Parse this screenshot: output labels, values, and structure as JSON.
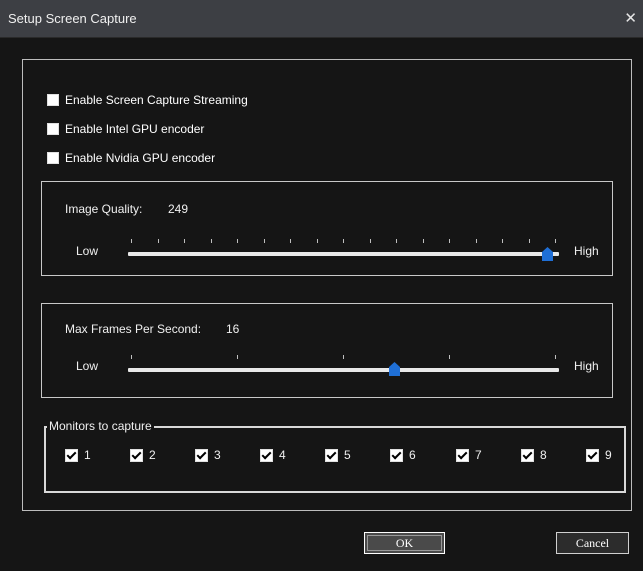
{
  "window": {
    "title": "Setup Screen Capture",
    "close_glyph": "✕"
  },
  "options": {
    "enable_streaming": {
      "label": "Enable Screen Capture Streaming",
      "checked": false
    },
    "enable_intel": {
      "label": "Enable Intel GPU encoder",
      "checked": false
    },
    "enable_nvidia": {
      "label": "Enable Nvidia GPU encoder",
      "checked": false
    }
  },
  "image_quality": {
    "label": "Image Quality:",
    "value": "249",
    "low_label": "Low",
    "high_label": "High",
    "level": 0.98
  },
  "max_fps": {
    "label": "Max Frames Per Second:",
    "value": "16",
    "low_label": "Low",
    "high_label": "High",
    "level": 0.62
  },
  "monitors": {
    "legend": "Monitors to capture",
    "items": [
      {
        "label": "1",
        "checked": true
      },
      {
        "label": "2",
        "checked": true
      },
      {
        "label": "3",
        "checked": true
      },
      {
        "label": "4",
        "checked": true
      },
      {
        "label": "5",
        "checked": true
      },
      {
        "label": "6",
        "checked": true
      },
      {
        "label": "7",
        "checked": true
      },
      {
        "label": "8",
        "checked": true
      },
      {
        "label": "9",
        "checked": true
      }
    ]
  },
  "buttons": {
    "ok": "OK",
    "cancel": "Cancel"
  },
  "colors": {
    "background": "#151515",
    "titlebar": "#3d3f44",
    "thumb": "#1f6fd6",
    "track": "#e8e8e8"
  }
}
